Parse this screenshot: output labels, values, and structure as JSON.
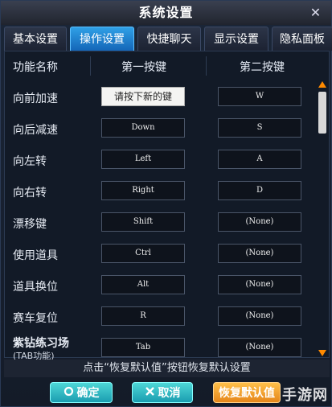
{
  "window": {
    "title": "系统设置",
    "close": "✕"
  },
  "tabs": [
    {
      "label": "基本设置"
    },
    {
      "label": "操作设置"
    },
    {
      "label": "快捷聊天"
    },
    {
      "label": "显示设置"
    },
    {
      "label": "隐私面板"
    }
  ],
  "columns": {
    "name": "功能名称",
    "first": "第一按键",
    "second": "第二按键"
  },
  "rows": [
    {
      "label": "向前加速",
      "first": "请按下新的键",
      "second": "W"
    },
    {
      "label": "向后减速",
      "first": "Down",
      "second": "S"
    },
    {
      "label": "向左转",
      "first": "Left",
      "second": "A"
    },
    {
      "label": "向右转",
      "first": "Right",
      "second": "D"
    },
    {
      "label": "漂移键",
      "first": "Shift",
      "second": "(None)"
    },
    {
      "label": "使用道具",
      "first": "Ctrl",
      "second": "(None)"
    },
    {
      "label": "道具换位",
      "first": "Alt",
      "second": "(None)"
    },
    {
      "label": "赛车复位",
      "first": "R",
      "second": "(None)"
    },
    {
      "label": "紫钻练习场",
      "sub": "(TAB功能)",
      "first": "Tab",
      "second": "(None)"
    }
  ],
  "hint": "点击“恢复默认值”按钮恢复默认设置",
  "buttons": {
    "ok": "确定",
    "cancel": "取消",
    "reset": "恢复默认值"
  },
  "watermark": "手游网",
  "colors": {
    "accent": "#1f8fe0",
    "scroll_arrow": "#ff8a00",
    "reset_button": "#f0a030",
    "ok_button": "#2fb8c4"
  }
}
